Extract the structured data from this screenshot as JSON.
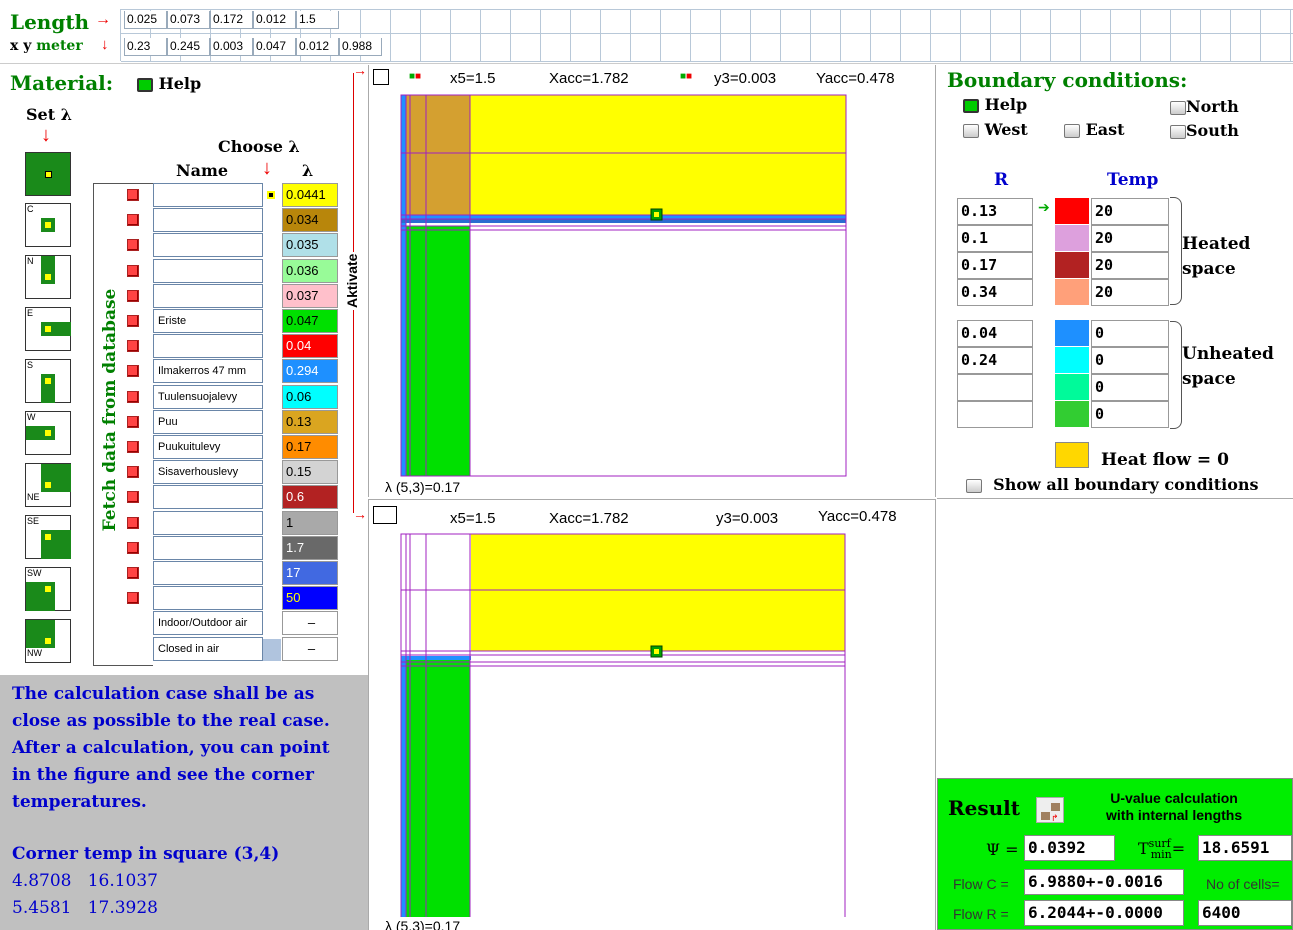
{
  "length": {
    "label": "Length",
    "values": [
      "0.025",
      "0.073",
      "0.172",
      "0.012",
      "1.5"
    ]
  },
  "xy": {
    "label": "x y",
    "unit": "meter",
    "values": [
      "0.23",
      "0.245",
      "0.003",
      "0.047",
      "0.012",
      "0.988"
    ]
  },
  "material": {
    "title": "Material:",
    "help": "Help",
    "set_lambda": "Set λ",
    "choose_lambda": "Choose λ",
    "col_name": "Name",
    "col_lambda": "λ",
    "fetch": "Fetch data from database",
    "aktivate": "Aktivate",
    "grid_labels": [
      "",
      "C",
      "N",
      "E",
      "S",
      "W",
      "NE",
      "SE",
      "SW",
      "NW"
    ],
    "rows": [
      {
        "name": "",
        "lambda": "0.0441",
        "color": "#ffff00"
      },
      {
        "name": "",
        "lambda": "0.034",
        "color": "#b8860b"
      },
      {
        "name": "",
        "lambda": "0.035",
        "color": "#b0e0e8"
      },
      {
        "name": "",
        "lambda": "0.036",
        "color": "#98fb98"
      },
      {
        "name": "",
        "lambda": "0.037",
        "color": "#ffc0cb"
      },
      {
        "name": "Eriste",
        "lambda": "0.047",
        "color": "#00e000"
      },
      {
        "name": "",
        "lambda": "0.04",
        "color": "#ff0000"
      },
      {
        "name": "Ilmakerros 47 mm",
        "lambda": "0.294",
        "color": "#1e90ff"
      },
      {
        "name": "Tuulensuojalevy",
        "lambda": "0.06",
        "color": "#00ffff"
      },
      {
        "name": "Puu",
        "lambda": "0.13",
        "color": "#daa520"
      },
      {
        "name": "Puukuitulevy",
        "lambda": "0.17",
        "color": "#ff8c00"
      },
      {
        "name": "Sisaverhouslevy",
        "lambda": "0.15",
        "color": "#d3d3d3"
      },
      {
        "name": "",
        "lambda": "0.6",
        "color": "#b22222"
      },
      {
        "name": "",
        "lambda": "1",
        "color": "#a9a9a9"
      },
      {
        "name": "",
        "lambda": "1.7",
        "color": "#696969"
      },
      {
        "name": "",
        "lambda": "17",
        "color": "#4169e1"
      },
      {
        "name": "",
        "lambda": "50",
        "color": "#0000ff"
      }
    ],
    "special": [
      {
        "name": "Indoor/Outdoor air",
        "lambda": "–"
      },
      {
        "name": "Closed in air",
        "lambda": "–"
      }
    ]
  },
  "info": {
    "text": "The calculation case shall be as close as possible to the real case. After a calculation, you can point in the figure and see the corner temperatures.",
    "corner_title": "Corner temp in square (3,4)",
    "r1": [
      "4.8708",
      "16.1037"
    ],
    "r2": [
      "5.4581",
      "17.3928"
    ]
  },
  "plot_top": {
    "x": "x5=1.5",
    "xacc": "Xacc=1.782",
    "y": "y3=0.003",
    "yacc": "Yacc=0.478",
    "lambda": "λ (5,3)=0.17"
  },
  "plot_bottom": {
    "x": "x5=1.5",
    "xacc": "Xacc=1.782",
    "y": "y3=0.003",
    "yacc": "Yacc=0.478",
    "lambda": "λ (5,3)=0.17"
  },
  "boundary": {
    "title": "Boundary conditions:",
    "help": "Help",
    "north": "North",
    "west": "West",
    "east": "East",
    "south": "South",
    "r_label": "R",
    "temp_label": "Temp",
    "heated": [
      {
        "r": "0.13",
        "temp": "20",
        "color": "#ff0000"
      },
      {
        "r": "0.1",
        "temp": "20",
        "color": "#dda0dd"
      },
      {
        "r": "0.17",
        "temp": "20",
        "color": "#b22222"
      },
      {
        "r": "0.34",
        "temp": "20",
        "color": "#ffa07a"
      }
    ],
    "unheated": [
      {
        "r": "0.04",
        "temp": "0",
        "color": "#1e90ff"
      },
      {
        "r": "0.24",
        "temp": "0",
        "color": "#00ffff"
      },
      {
        "r": "",
        "temp": "0",
        "color": "#00fa9a"
      },
      {
        "r": "",
        "temp": "0",
        "color": "#32cd32"
      }
    ],
    "heated_label1": "Heated",
    "heated_label2": "space",
    "unheated_label1": "Unheated",
    "unheated_label2": "space",
    "heatflow": "Heat flow = 0",
    "show_all": "Show all boundary conditions"
  },
  "result": {
    "title": "Result",
    "subtitle1": "U-value calculation",
    "subtitle2": "with internal lengths",
    "psi_label": "Ψ =",
    "psi": "0.0392",
    "t_label": "T",
    "t_sup": "surf",
    "t_sub": "min",
    "t_eq": "=",
    "tsurf": "18.6591",
    "flowc_label": "Flow C =",
    "flowc": "6.9880+-0.0016",
    "cells_label": "No of cells=",
    "flowr_label": "Flow R =",
    "flowr": "6.2044+-0.0000",
    "cells": "6400"
  }
}
